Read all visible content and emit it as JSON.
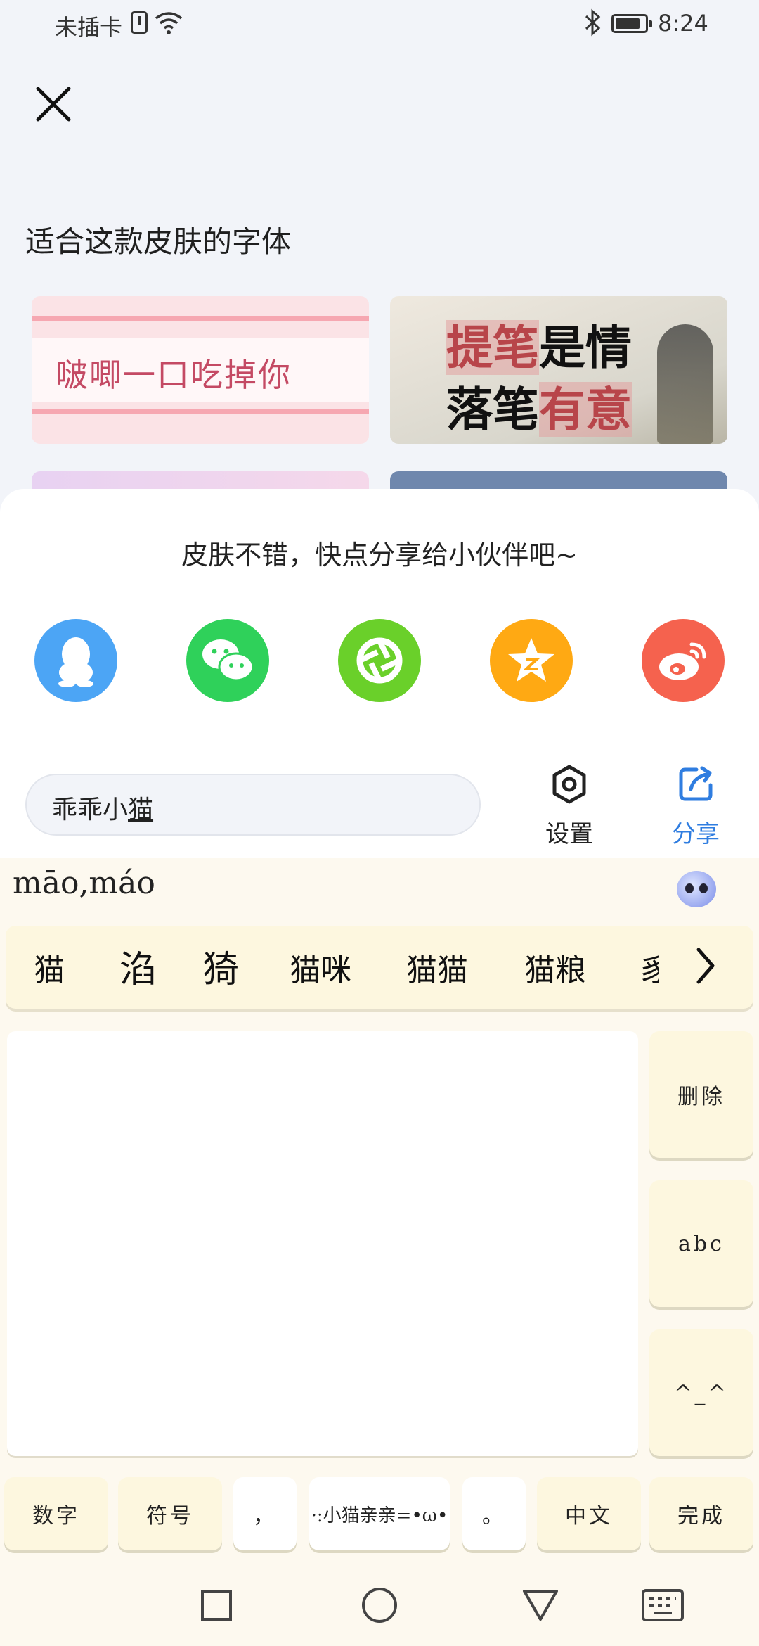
{
  "status_bar": {
    "carrier": "未插卡",
    "time": "8:24"
  },
  "font_section": {
    "title": "适合这款皮肤的字体",
    "card1_text": "啵唧一口吃掉你",
    "card2_line1": [
      "提笔",
      "是情"
    ],
    "card2_line2": [
      "落笔",
      "有意"
    ]
  },
  "share_panel": {
    "title": "皮肤不错，快点分享给小伙伴吧~",
    "targets": [
      "qq-icon",
      "wechat-icon",
      "moments-icon",
      "qzone-icon",
      "weibo-icon"
    ]
  },
  "input_bar": {
    "text_plain": "乖乖小",
    "text_composing": "猫",
    "settings_label": "设置",
    "share_label": "分享"
  },
  "keyboard": {
    "pinyin": "māo,máo",
    "candidates": [
      "猫",
      "淊",
      "猗",
      "猫咪",
      "猫猫",
      "猫粮",
      "豸"
    ],
    "side_keys": [
      "删除",
      "abc",
      "^_^"
    ],
    "bottom_keys": [
      "数字",
      "符号",
      "，",
      "·:小猫亲亲=•ω•",
      "。",
      "中文",
      "完成"
    ]
  },
  "colors": {
    "accent_blue": "#2f7de0",
    "keyboard_bg": "#fdf9ef",
    "key_bg": "#fdf7df"
  }
}
